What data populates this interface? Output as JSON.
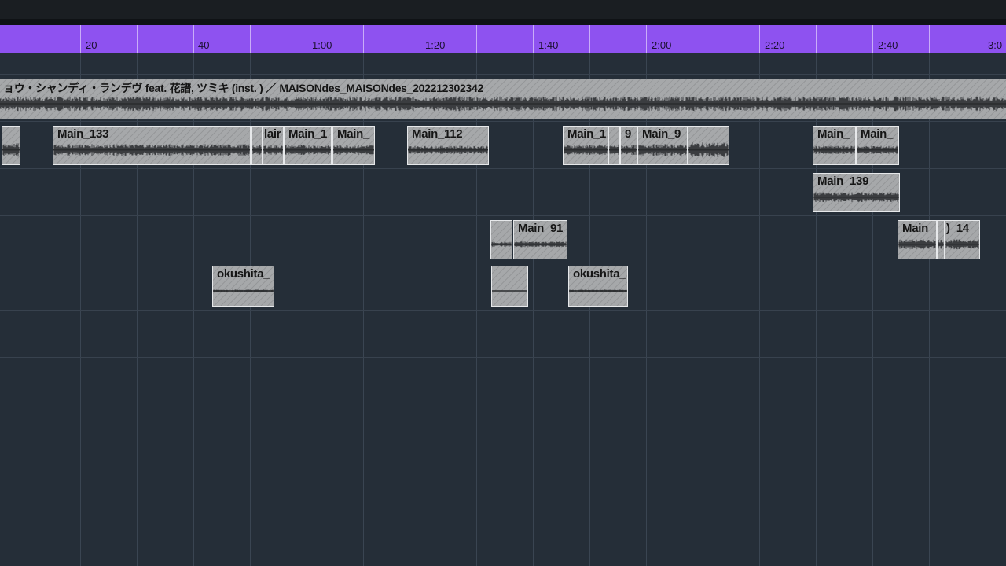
{
  "ruler": {
    "labels": [
      "20",
      "40",
      "1:00",
      "1:20",
      "1:40",
      "2:00",
      "2:20",
      "2:40",
      "3:0"
    ]
  },
  "tracks": {
    "master": {
      "label": "ョウ・シャンディ・ランデヴ feat. 花譜, ツミキ (inst. ) ／ MAISONdes_MAISONdes_202212302342"
    },
    "t1": [
      "",
      "Main_133",
      "",
      "lair",
      "Main_1",
      "Main_",
      "Main_112",
      "Main_1",
      "",
      "9",
      "Main_9",
      ""
    ],
    "t2": [
      "Main_",
      "Main_",
      "Main_139"
    ],
    "t3": [
      "",
      "Main_91",
      "Main",
      ")_14"
    ],
    "t4": [
      "okushita_",
      "",
      "okushita_"
    ]
  },
  "colors": {
    "ruler": "#8e52f0",
    "background": "#252e38",
    "clip": "#a6a8aa",
    "clip_border": "#e6e8ea"
  }
}
